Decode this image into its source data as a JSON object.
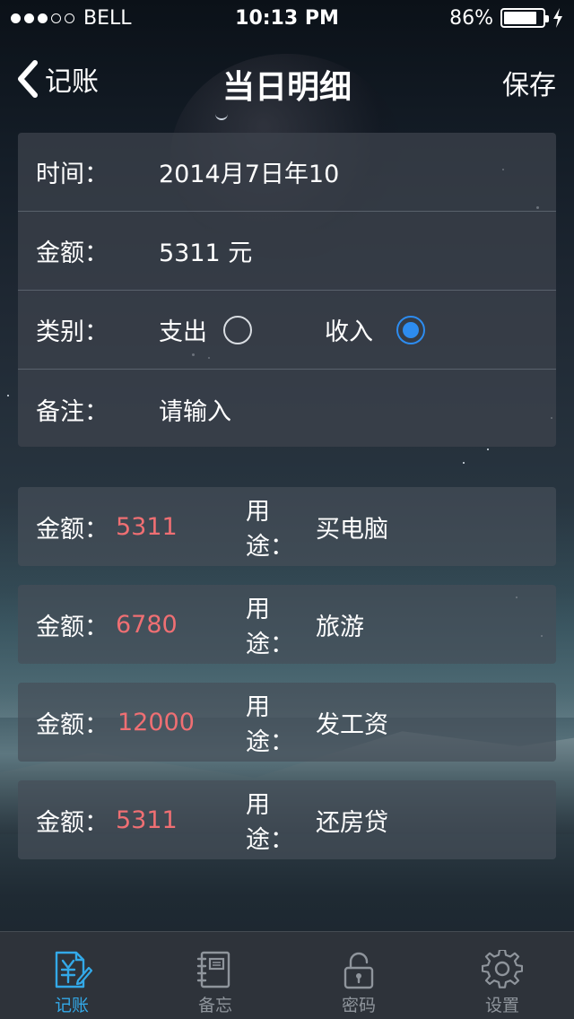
{
  "status_bar": {
    "signal_dots_filled": 3,
    "signal_dots_total": 5,
    "carrier": "BELL",
    "time": "10:13 PM",
    "battery": "86%",
    "battery_level": 0.86
  },
  "nav": {
    "back_label": "记账",
    "title": "当日明细",
    "save_label": "保存"
  },
  "form": {
    "time_label": "时间：",
    "time_value": "2014月7日年10",
    "amount_label": "金额：",
    "amount_value": "5311 元",
    "category_label": "类别：",
    "expense_label": "支出",
    "income_label": "收入",
    "selected_category": "收入",
    "note_label": "备注：",
    "note_placeholder": "请输入"
  },
  "records": [
    {
      "amount_label": "金额：",
      "amount": "5311",
      "use_label": "用途：",
      "use": "买电脑"
    },
    {
      "amount_label": "金额：",
      "amount": "6780",
      "use_label": "用途：",
      "use": "旅游"
    },
    {
      "amount_label": "金额：",
      "amount": "12000",
      "use_label": "用途：",
      "use": "发工资"
    },
    {
      "amount_label": "金额：",
      "amount": "5311",
      "use_label": "用途：",
      "use": "还房贷"
    }
  ],
  "tab_bar": {
    "active": "记账",
    "tabs": [
      {
        "label": "记账",
        "icon": "bookkeeping-icon"
      },
      {
        "label": "备忘",
        "icon": "notebook-icon"
      },
      {
        "label": "密码",
        "icon": "lock-icon"
      },
      {
        "label": "设置",
        "icon": "gear-icon"
      }
    ]
  },
  "colors": {
    "accent": "#2d8cf0",
    "amount_red": "#ef6f73",
    "tab_active": "#33a9e8",
    "tab_inactive": "#8f959c"
  }
}
